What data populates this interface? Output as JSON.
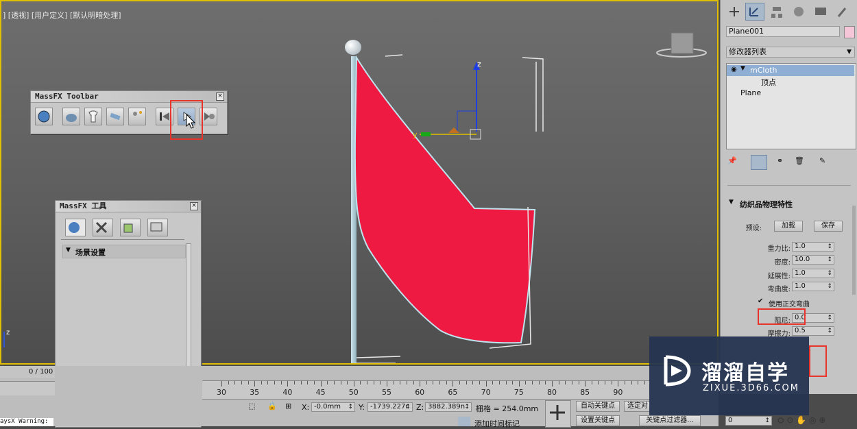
{
  "viewport": {
    "label": "] [透视] [用户定义] [默认明暗处理]",
    "gizmo_labels": {
      "z": "z",
      "y": "y",
      "axis_z": "z"
    }
  },
  "massfx_toolbar": {
    "title": "MassFX Toolbar"
  },
  "massfx_tools": {
    "title": "MassFX 工具",
    "section": "场景设置"
  },
  "cmd_panel": {
    "object_name": "Plane001",
    "modifier_list_label": "修改器列表",
    "stack": [
      {
        "label": "mCloth",
        "selected": true
      },
      {
        "label": "顶点",
        "sub": true
      },
      {
        "label": "Plane"
      }
    ],
    "rollout_title": "纺织品物理特性",
    "preset_label": "预设:",
    "load_button": "加载",
    "save_button": "保存",
    "params": [
      {
        "label": "重力比:",
        "value": "1.0"
      },
      {
        "label": "密度:",
        "value": "10.0"
      },
      {
        "label": "延展性:",
        "value": "1.0"
      },
      {
        "label": "弯曲度:",
        "value": "1.0"
      }
    ],
    "ortho_bend_label": "使用正交弯曲",
    "damping": {
      "label": "阻尼:",
      "value": "0.0"
    },
    "friction": {
      "label": "摩擦力:",
      "value": "0.5"
    }
  },
  "timeline": {
    "frame_counter": "0 / 100",
    "ticks": [
      "30",
      "35",
      "40",
      "45",
      "50",
      "55",
      "60",
      "65",
      "70",
      "75",
      "80",
      "85",
      "90"
    ],
    "x_label": "X:",
    "x_value": "-0.0mm",
    "y_label": "Y:",
    "y_value": "-1739.227r",
    "z_label": "Z:",
    "z_value": "3882.389n",
    "grid_label": "栅格 = 254.0mm",
    "auto_key": "自动关键点",
    "set_key": "设置关键点",
    "selected": "选定对",
    "key_filter": "关键点过滤器...",
    "add_time_tag": "添加时间标记",
    "frame_value": "0",
    "warning": "aysX Warning:"
  },
  "watermark": {
    "title": "溜溜自学",
    "url": "ZIXUE.3D66.COM"
  },
  "colors": {
    "flag": "#ef1a42",
    "viewport_border": "#e0c000",
    "highlight": "#e8332a",
    "watermark_bg": "#263450"
  }
}
